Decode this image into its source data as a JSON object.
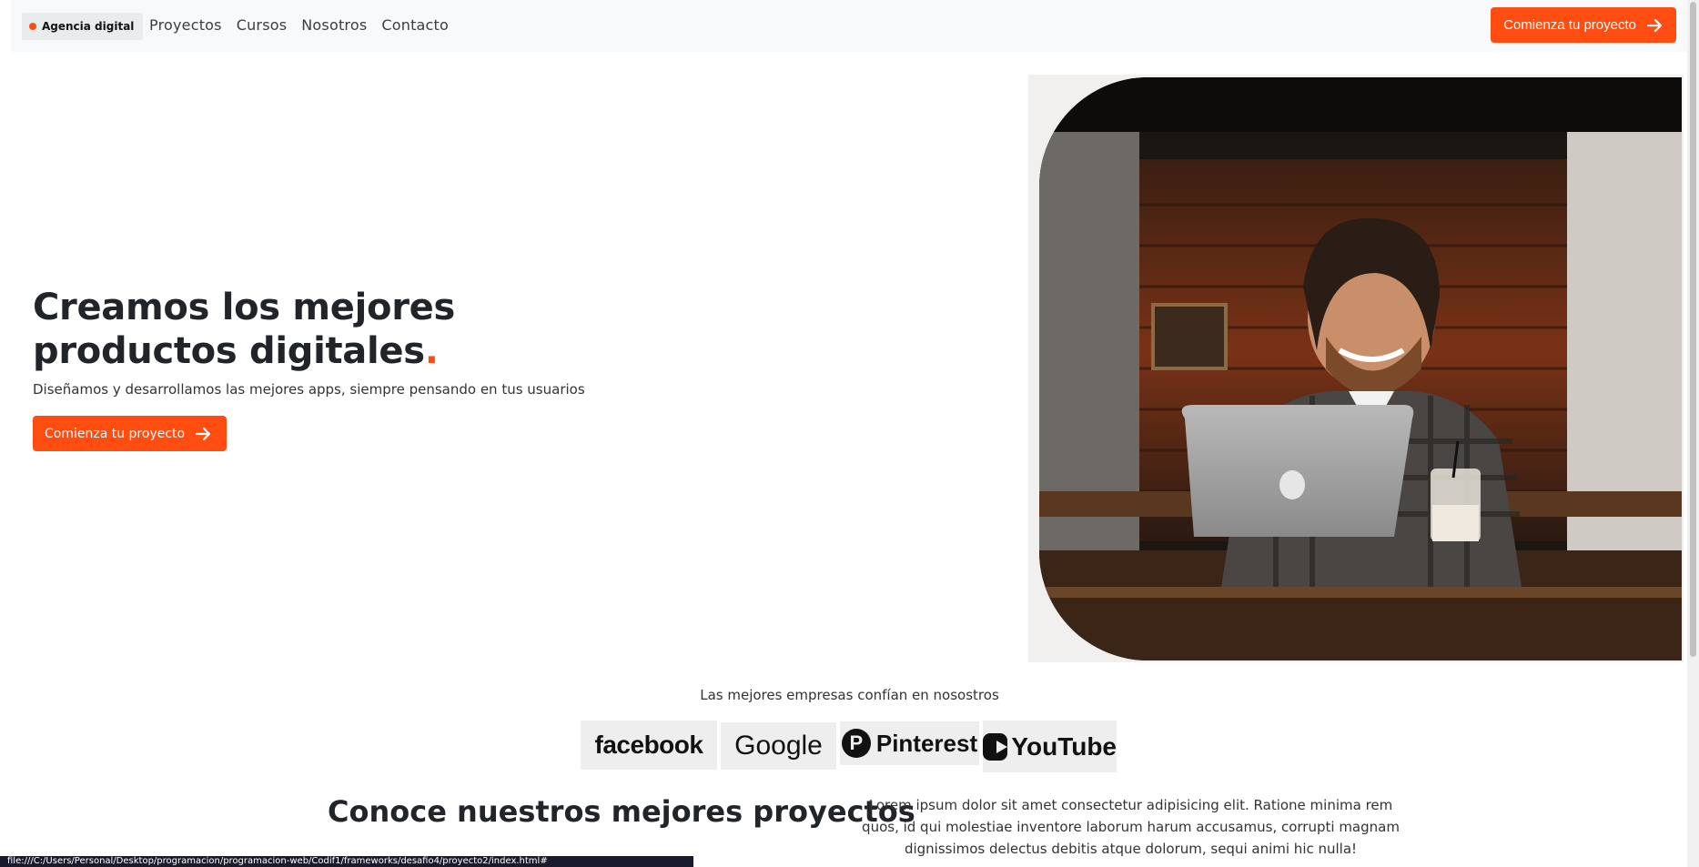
{
  "header": {
    "logo_label": "Agencia digital",
    "nav": [
      "Proyectos",
      "Cursos",
      "Nosotros",
      "Contacto"
    ],
    "cta_label": "Comienza tu proyecto"
  },
  "hero": {
    "title": "Creamos los mejores productos digitales",
    "title_accent": ".",
    "subtitle": "Diseñamos y desarrollamos las mejores apps, siempre pensando en tus usuarios",
    "cta_label": "Comienza tu proyecto"
  },
  "trusted": {
    "label": "Las mejores empresas confían en nosostros",
    "brands": [
      "facebook",
      "Google",
      "Pinterest",
      "YouTube"
    ]
  },
  "projects": {
    "title": "Conoce nuestros mejores proyectos",
    "text": "Lorem ipsum dolor sit amet consectetur adipisicing elit. Ratione minima rem quos, id qui molestiae inventore laborum harum accusamus, corrupti magnam dignissimos delectus debitis atque dolorum, sequi animi hic nulla!"
  },
  "status_bar": "file:///C:/Users/Personal/Desktop/programacion/programacion-web/Codif1/frameworks/desafio4/proyecto2/index.html#",
  "colors": {
    "accent": "#ff4d12",
    "header_bg": "#f8f9fa"
  }
}
